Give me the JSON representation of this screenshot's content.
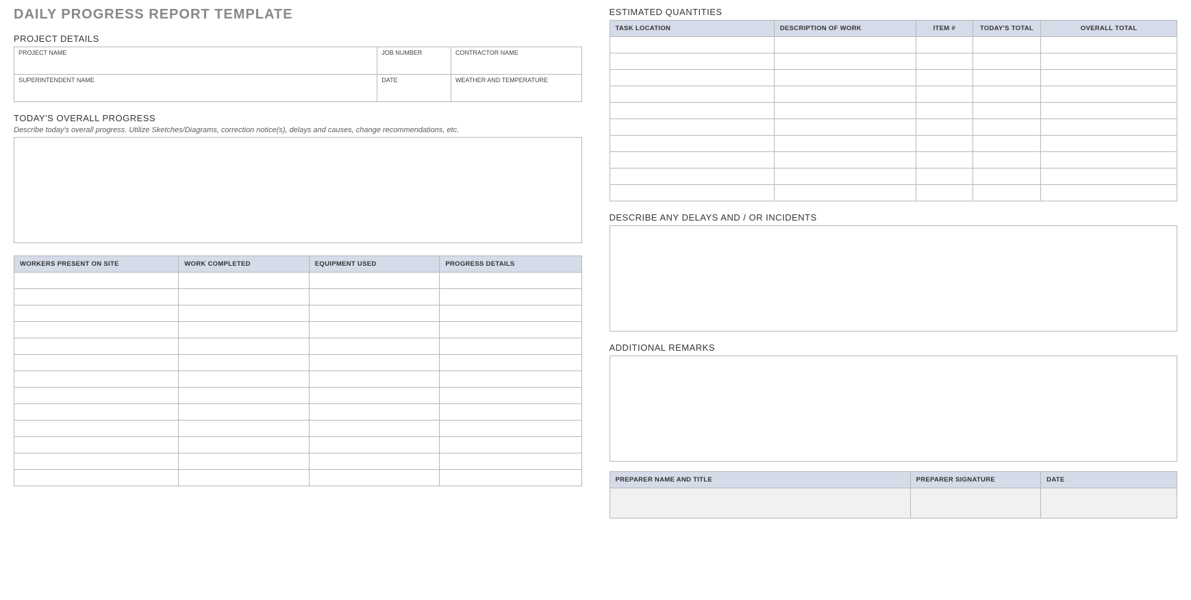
{
  "title": "DAILY PROGRESS REPORT TEMPLATE",
  "project_details": {
    "heading": "PROJECT DETAILS",
    "project_name_label": "PROJECT NAME",
    "job_number_label": "JOB NUMBER",
    "contractor_name_label": "CONTRACTOR NAME",
    "superintendent_name_label": "SUPERINTENDENT NAME",
    "date_label": "DATE",
    "weather_label": "WEATHER AND TEMPERATURE",
    "project_name": "",
    "job_number": "",
    "contractor_name": "",
    "superintendent_name": "",
    "date": "",
    "weather": ""
  },
  "overall_progress": {
    "heading": "TODAY'S OVERALL PROGRESS",
    "desc": "Describe today's overall progress.  Utilize Sketches/Diagrams, correction notice(s), delays and causes, change recommendations, etc.",
    "text": ""
  },
  "work_table": {
    "headers": {
      "workers": "WORKERS PRESENT ON SITE",
      "completed": "WORK COMPLETED",
      "equipment": "EQUIPMENT USED",
      "details": "PROGRESS DETAILS"
    },
    "rows": [
      {
        "workers": "",
        "completed": "",
        "equipment": "",
        "details": ""
      },
      {
        "workers": "",
        "completed": "",
        "equipment": "",
        "details": ""
      },
      {
        "workers": "",
        "completed": "",
        "equipment": "",
        "details": ""
      },
      {
        "workers": "",
        "completed": "",
        "equipment": "",
        "details": ""
      },
      {
        "workers": "",
        "completed": "",
        "equipment": "",
        "details": ""
      },
      {
        "workers": "",
        "completed": "",
        "equipment": "",
        "details": ""
      },
      {
        "workers": "",
        "completed": "",
        "equipment": "",
        "details": ""
      },
      {
        "workers": "",
        "completed": "",
        "equipment": "",
        "details": ""
      },
      {
        "workers": "",
        "completed": "",
        "equipment": "",
        "details": ""
      },
      {
        "workers": "",
        "completed": "",
        "equipment": "",
        "details": ""
      },
      {
        "workers": "",
        "completed": "",
        "equipment": "",
        "details": ""
      },
      {
        "workers": "",
        "completed": "",
        "equipment": "",
        "details": ""
      },
      {
        "workers": "",
        "completed": "",
        "equipment": "",
        "details": ""
      }
    ]
  },
  "quantities_table": {
    "heading": "ESTIMATED QUANTITIES",
    "headers": {
      "location": "TASK LOCATION",
      "desc": "DESCRIPTION OF WORK",
      "item": "ITEM #",
      "today": "TODAY'S TOTAL",
      "overall": "OVERALL TOTAL"
    },
    "rows": [
      {
        "location": "",
        "desc": "",
        "item": "",
        "today": "",
        "overall": ""
      },
      {
        "location": "",
        "desc": "",
        "item": "",
        "today": "",
        "overall": ""
      },
      {
        "location": "",
        "desc": "",
        "item": "",
        "today": "",
        "overall": ""
      },
      {
        "location": "",
        "desc": "",
        "item": "",
        "today": "",
        "overall": ""
      },
      {
        "location": "",
        "desc": "",
        "item": "",
        "today": "",
        "overall": ""
      },
      {
        "location": "",
        "desc": "",
        "item": "",
        "today": "",
        "overall": ""
      },
      {
        "location": "",
        "desc": "",
        "item": "",
        "today": "",
        "overall": ""
      },
      {
        "location": "",
        "desc": "",
        "item": "",
        "today": "",
        "overall": ""
      },
      {
        "location": "",
        "desc": "",
        "item": "",
        "today": "",
        "overall": ""
      },
      {
        "location": "",
        "desc": "",
        "item": "",
        "today": "",
        "overall": ""
      }
    ]
  },
  "delays": {
    "heading": "DESCRIBE ANY DELAYS AND / OR INCIDENTS",
    "text": ""
  },
  "remarks": {
    "heading": "ADDITIONAL REMARKS",
    "text": ""
  },
  "signoff": {
    "headers": {
      "name": "PREPARER NAME AND TITLE",
      "signature": "PREPARER SIGNATURE",
      "date": "DATE"
    },
    "name": "",
    "signature": "",
    "date": ""
  }
}
